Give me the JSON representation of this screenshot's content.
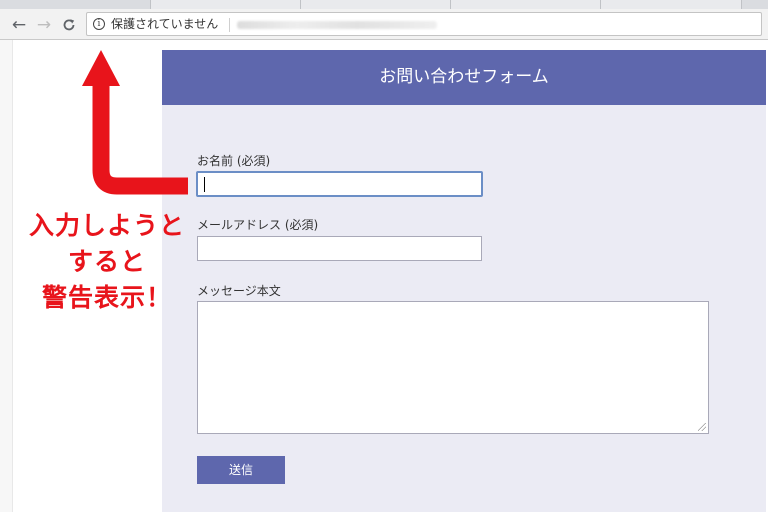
{
  "browser": {
    "security_text": "保護されていません",
    "icons": {
      "back": "arrow-left-icon",
      "forward": "arrow-right-icon",
      "reload": "reload-icon",
      "info": "info-icon"
    }
  },
  "form": {
    "title": "お問い合わせフォーム",
    "name_label": "お名前 (必須)",
    "name_value": "",
    "email_label": "メールアドレス (必須)",
    "email_value": "",
    "message_label": "メッセージ本文",
    "message_value": "",
    "submit_label": "送信"
  },
  "annotation": {
    "line1": "入力しようと",
    "line2": "すると",
    "line3": "警告表示！",
    "color": "#e8141b"
  },
  "colors": {
    "accent": "#5e67ad",
    "panel_bg": "#ebebf4",
    "focus_border": "#6b8ec6"
  }
}
